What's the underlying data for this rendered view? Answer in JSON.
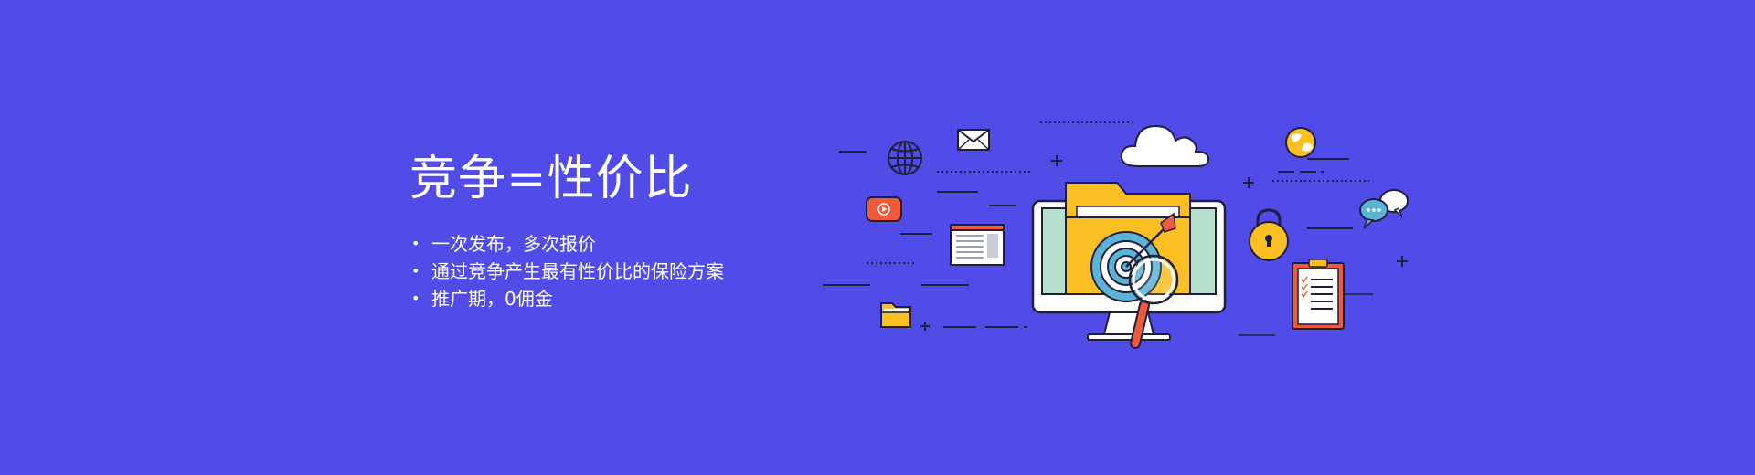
{
  "banner": {
    "title": "竞争=性价比",
    "bullets": [
      "一次发布，多次报价",
      "通过竞争产生最有性价比的保险方案",
      "推广期，0佣金"
    ]
  },
  "colors": {
    "background": "#514be8",
    "text": "#ffffff",
    "folder_yellow": "#fbbf24",
    "accent_red": "#ef5a3c",
    "monitor_teal": "#b4e0cc",
    "stroke": "#1f1f3a"
  },
  "illustration_icons": [
    "globe-icon",
    "envelope-icon",
    "cloud-icon",
    "world-icon",
    "play-button-icon",
    "browser-window-icon",
    "monitor-icon",
    "folder-icon",
    "target-icon",
    "arrow-icon",
    "magnifier-icon",
    "padlock-icon",
    "chat-bubbles-icon",
    "clipboard-checklist-icon",
    "small-folder-icon"
  ]
}
